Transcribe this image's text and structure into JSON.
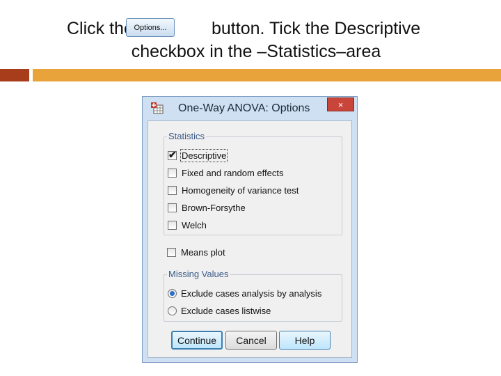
{
  "slide": {
    "instruction_part1": "Click the",
    "instruction_part2": "button. Tick the Descriptive",
    "instruction_line2": "checkbox in the –Statistics–area",
    "inline_button_label": "Options..."
  },
  "colors": {
    "bar_red": "#a83d1c",
    "bar_orange": "#e8a33a",
    "dialog_frame": "#cfe0f2",
    "close_button": "#c9453a"
  },
  "dialog": {
    "title": "One-Way ANOVA: Options",
    "close_label": "×",
    "app_icon": "spss-dialog-icon",
    "statistics": {
      "legend": "Statistics",
      "options": [
        {
          "label": "Descriptive",
          "checked": true
        },
        {
          "label": "Fixed and random effects",
          "checked": false
        },
        {
          "label": "Homogeneity of variance test",
          "checked": false
        },
        {
          "label": "Brown-Forsythe",
          "checked": false
        },
        {
          "label": "Welch",
          "checked": false
        }
      ]
    },
    "means_plot": {
      "label": "Means plot",
      "checked": false
    },
    "missing_values": {
      "legend": "Missing Values",
      "options": [
        {
          "label": "Exclude cases analysis by analysis",
          "selected": true
        },
        {
          "label": "Exclude cases listwise",
          "selected": false
        }
      ]
    },
    "buttons": {
      "continue": "Continue",
      "cancel": "Cancel",
      "help": "Help"
    }
  }
}
